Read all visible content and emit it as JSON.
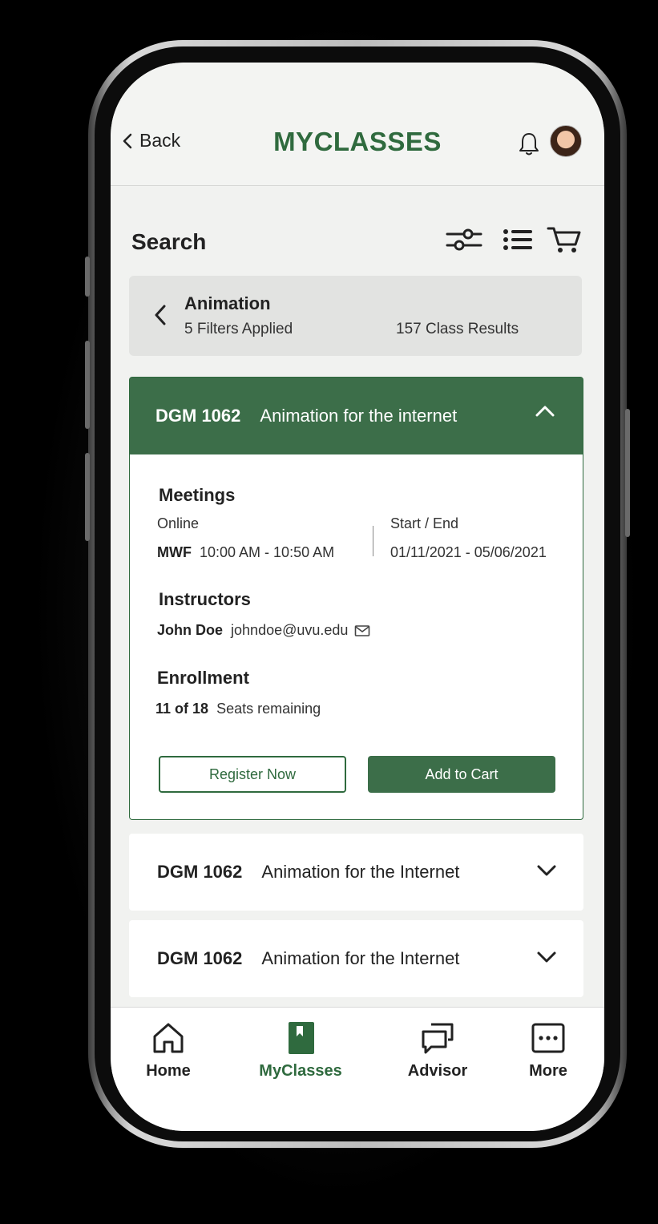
{
  "header": {
    "back_label": "Back",
    "app_title": "MYCLASSES"
  },
  "search": {
    "title": "Search",
    "filter_term": "Animation",
    "filters_applied": "5 Filters Applied",
    "results_count": "157 Class Results"
  },
  "expanded_course": {
    "code": "DGM 1062",
    "title": "Animation for the internet",
    "meetings_heading": "Meetings",
    "mode": "Online",
    "days": "MWF",
    "time": "10:00 AM - 10:50 AM",
    "start_end_label": "Start / End",
    "date_range": "01/11/2021 - 05/06/2021",
    "instructors_heading": "Instructors",
    "instructor_name": "John Doe",
    "instructor_email": "johndoe@uvu.edu",
    "enrollment_heading": "Enrollment",
    "seats_count": "11 of 18",
    "seats_label": "Seats remaining",
    "register_button": "Register Now",
    "cart_button": "Add to Cart"
  },
  "collapsed_courses": [
    {
      "code": "DGM 1062",
      "title": "Animation for the Internet"
    },
    {
      "code": "DGM 1062",
      "title": "Animation for the Internet"
    }
  ],
  "bottom_nav": [
    {
      "label": "Home",
      "icon": "home-icon",
      "active": false
    },
    {
      "label": "MyClasses",
      "icon": "book-icon",
      "active": true
    },
    {
      "label": "Advisor",
      "icon": "chat-icon",
      "active": false
    },
    {
      "label": "More",
      "icon": "more-icon",
      "active": false
    }
  ],
  "colors": {
    "brand_green": "#2f6a3e",
    "card_header_green": "#3c6e49",
    "background": "#f1f2f0"
  }
}
